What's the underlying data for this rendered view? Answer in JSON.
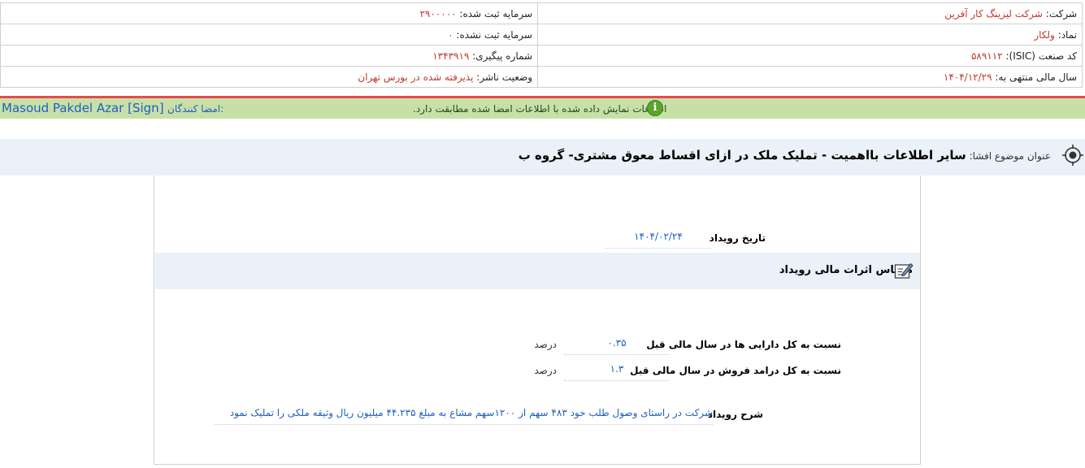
{
  "company_info": {
    "rows": [
      {
        "right_label": "شرکت:",
        "right_value": "شرکت لیزینگ کار آفرین",
        "left_label": "سرمایه ثبت شده:",
        "left_value": "۲۹۰۰۰۰۰"
      },
      {
        "right_label": "نماد:",
        "right_value": "ولکار",
        "left_label": "سرمایه ثبت نشده:",
        "left_value": "۰"
      },
      {
        "right_label": "کد صنعت (ISIC):",
        "right_value": "۵۸۹۱۱۲",
        "left_label": "شماره پیگیری:",
        "left_value": "۱۳۴۳۹۱۹"
      },
      {
        "right_label": "سال مالی منتهی به:",
        "right_value": "۱۴۰۴/۱۲/۲۹",
        "left_label": "وضعیت ناشر:",
        "left_value": "پذیرفته شده در بورس تهران"
      }
    ]
  },
  "signature": {
    "signers_label": "امضا کنندگان:",
    "signer": "Masoud Pakdel Azar [Sign]",
    "confirm_text": "اطلاعات نمایش داده شده با اطلاعات امضا شده مطابقت دارد.",
    "confirm_icon": "info-icon",
    "bar_color": "#c8e0a8"
  },
  "subject": {
    "label": "عنوان موضوع افشا:",
    "value": "سایر اطلاعات بااهمیت - تملیک ملک در ازای اقساط معوق مشتری- گروه ب",
    "icon": "target-icon"
  },
  "event": {
    "date_label": "تاریخ رویداد",
    "date_value": "۱۴۰۴/۰۲/۲۴",
    "section_title": "مقیاس اثرات مالی رویداد",
    "section_icon": "note-edit-icon",
    "metrics": [
      {
        "label": "نسبت به کل دارایی ها در سال مالی قبل",
        "value": "۰.۳۵",
        "unit": "درصد"
      },
      {
        "label": "نسبت به کل درامد فروش در سال مالی قبل",
        "value": "۱.۳",
        "unit": "درصد"
      }
    ],
    "description_label": "شرح رویداد",
    "description_value": "شرکت در راستای وصول طلب خود ۴۸۳ سهم از ۱۲۰۰سهم مشاع به مبلغ ۴۴.۲۳۵ میلیون ریال وثیقه ملکی را تملیک نمود"
  },
  "colors": {
    "label_value_red": "#c0392b",
    "link_blue": "#1f5fbf",
    "divider_red": "#e84a4a",
    "header_bg": "#eaf1f8"
  }
}
